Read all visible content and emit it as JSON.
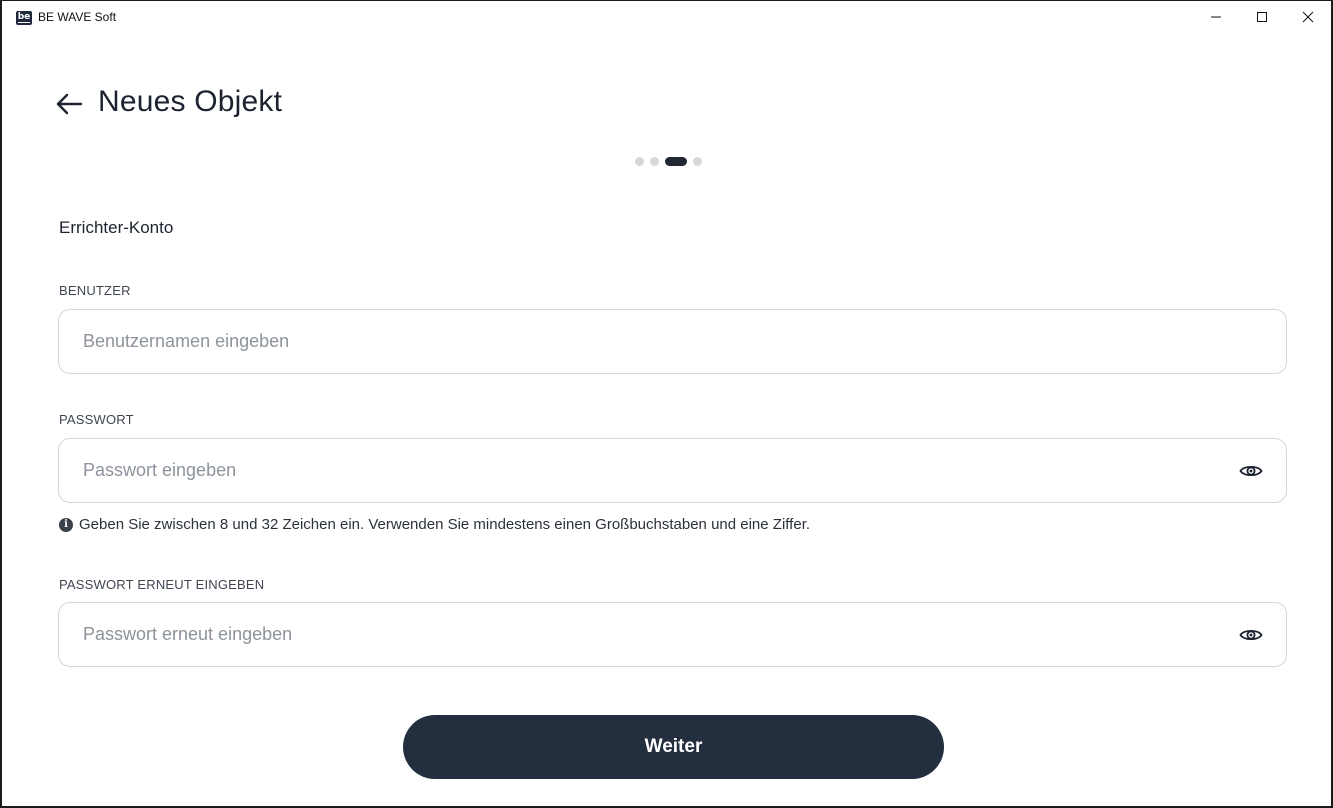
{
  "window": {
    "title": "BE WAVE Soft",
    "logo_text": "be"
  },
  "header": {
    "title": "Neues Objekt"
  },
  "stepper": {
    "total_steps": 4,
    "active_step": 3
  },
  "form": {
    "section_title": "Errichter-Konto",
    "user": {
      "label": "BENUTZER",
      "placeholder": "Benutzernamen eingeben",
      "value": ""
    },
    "password": {
      "label": "PASSWORT",
      "placeholder": "Passwort eingeben",
      "value": ""
    },
    "password_hint": "Geben Sie zwischen 8 und 32 Zeichen ein. Verwenden Sie mindestens einen Großbuchstaben und eine Ziffer.",
    "password_repeat": {
      "label": "PASSWORT ERNEUT EINGEBEN",
      "placeholder": "Passwort erneut eingeben",
      "value": ""
    },
    "submit_label": "Weiter"
  },
  "icons": {
    "back": "arrow-left-icon",
    "eye": "eye-icon",
    "info": "info-icon"
  },
  "colors": {
    "primary": "#232e3f",
    "dot_inactive": "#d5d7da",
    "dot_active": "#222831"
  }
}
